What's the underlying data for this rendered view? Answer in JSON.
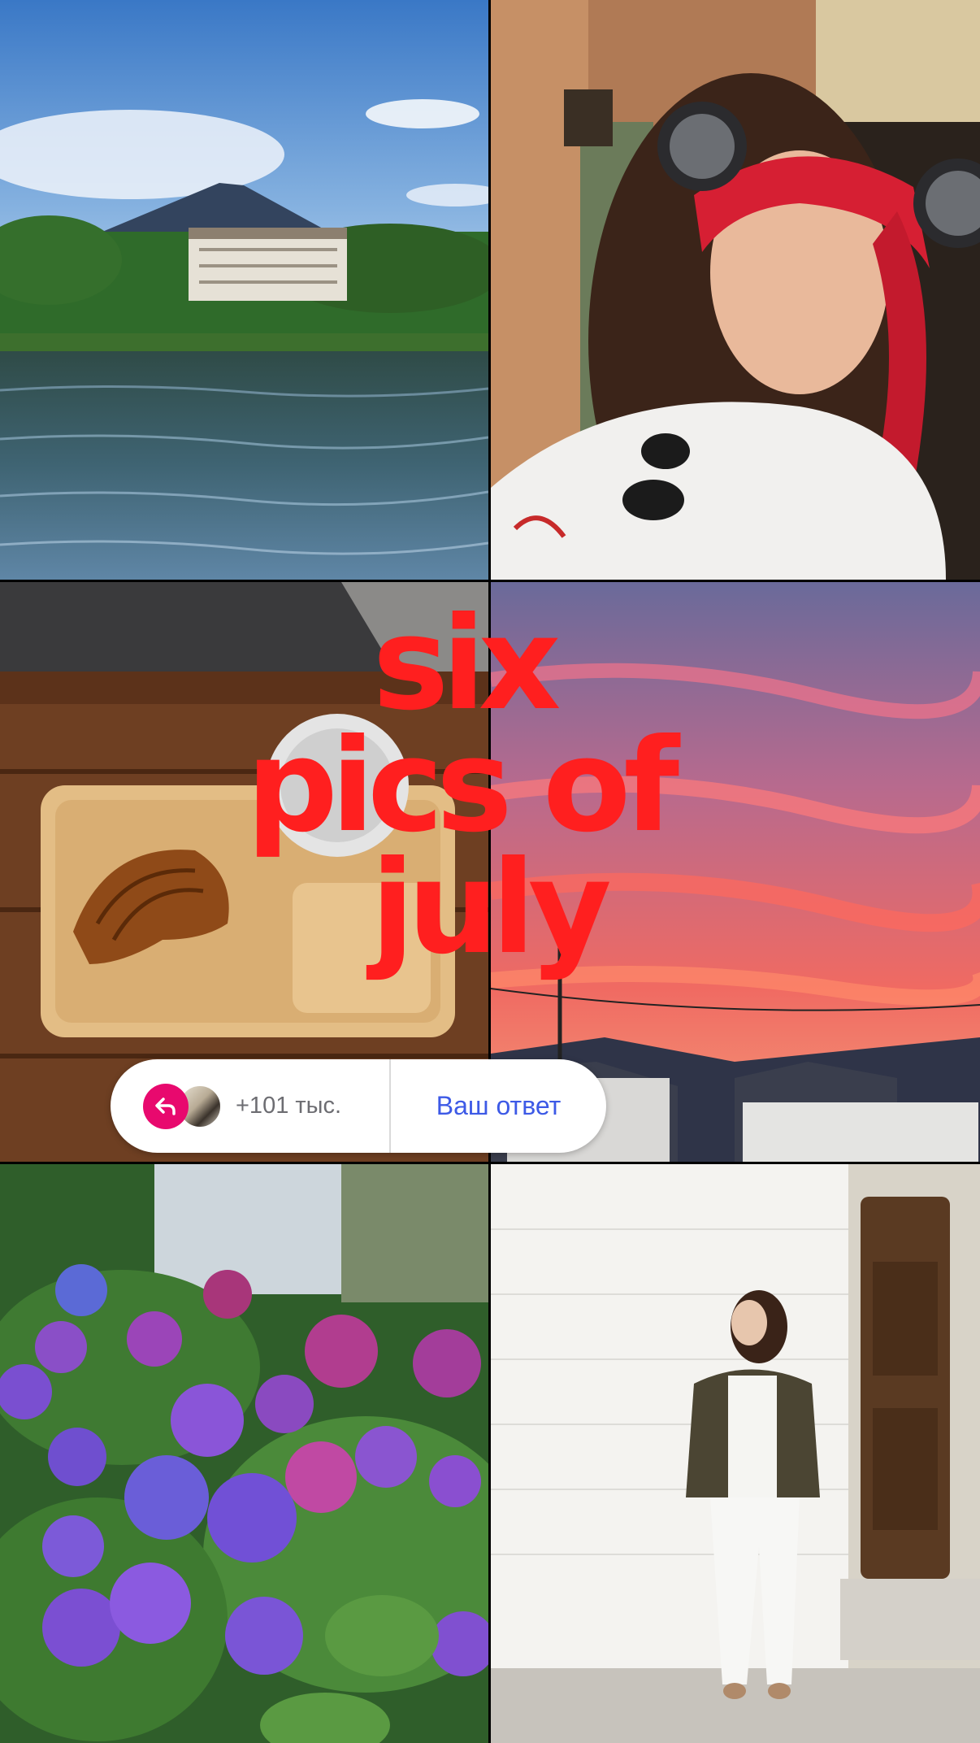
{
  "title": {
    "line1": "six",
    "line2": "pics of",
    "line3": "july"
  },
  "reply_bar": {
    "count_label": "+101 тыс.",
    "answer_label": "Ваш ответ",
    "reply_icon": "reply-arrow-icon",
    "accent_color": "#e8096e",
    "answer_color": "#3d5ae6"
  },
  "photos": [
    {
      "subject": "lake-and-mountain"
    },
    {
      "subject": "selfie-red-bandana"
    },
    {
      "subject": "croissant-on-wooden-tray"
    },
    {
      "subject": "sunset-sky"
    },
    {
      "subject": "purple-hydrangeas"
    },
    {
      "subject": "woman-by-white-wall"
    }
  ],
  "colors": {
    "title": "#ff1f1f"
  }
}
